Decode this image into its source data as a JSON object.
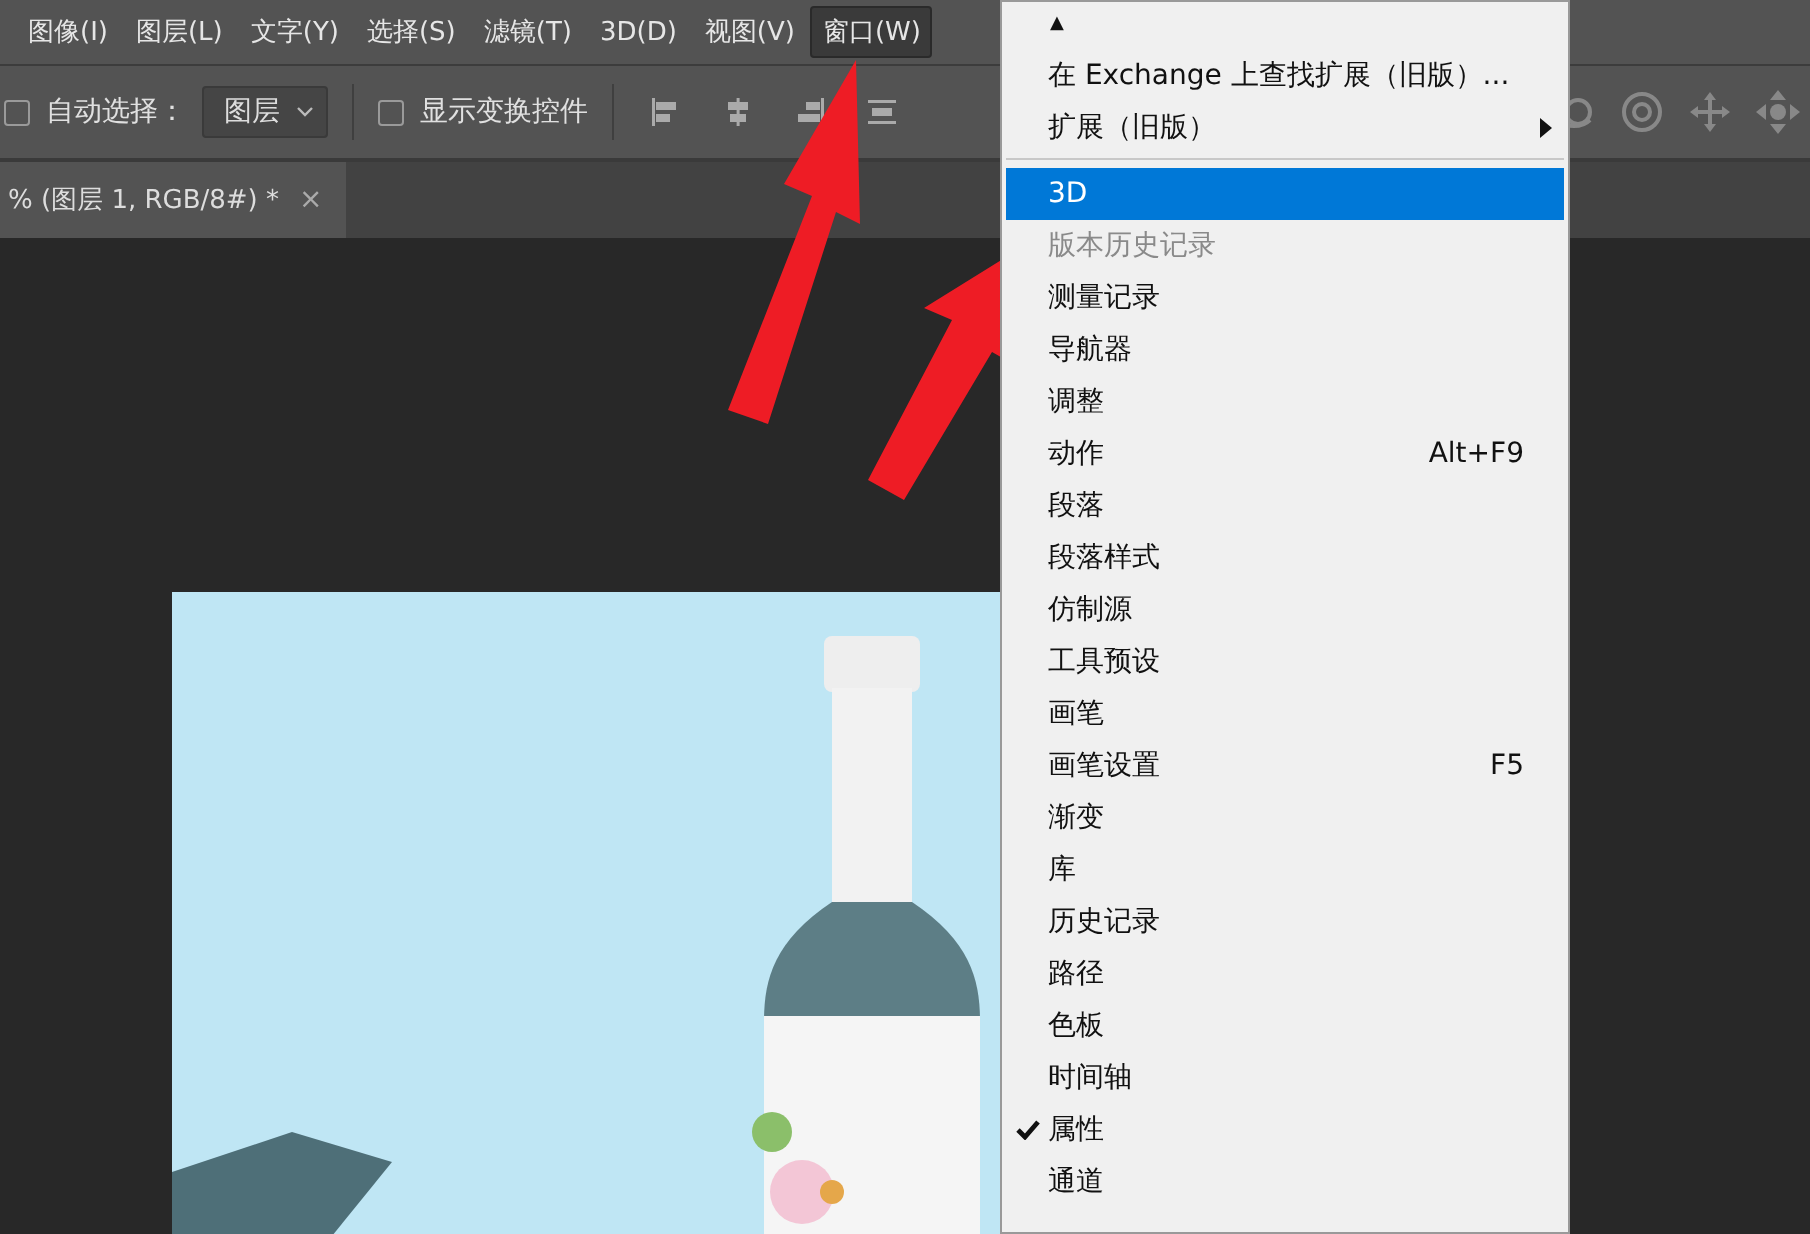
{
  "menu_bar": [
    {
      "label": "图像(I)",
      "selected": false
    },
    {
      "label": "图层(L)",
      "selected": false
    },
    {
      "label": "文字(Y)",
      "selected": false
    },
    {
      "label": "选择(S)",
      "selected": false
    },
    {
      "label": "滤镜(T)",
      "selected": false
    },
    {
      "label": "3D(D)",
      "selected": false
    },
    {
      "label": "视图(V)",
      "selected": false
    },
    {
      "label": "窗口(W)",
      "selected": true
    }
  ],
  "options_bar": {
    "auto_select": {
      "checked": false
    },
    "auto_select_label": "自动选择：",
    "auto_select_target": "图层",
    "transform_controls": {
      "label": "显示变换控件",
      "checked": false
    }
  },
  "document_tab": {
    "title": "% (图层 1, RGB/8#) *",
    "close": "×"
  },
  "window_menu": {
    "scroll_up": "▲",
    "items": [
      {
        "label": "在 Exchange 上查找扩展（旧版）...",
        "kind": "item",
        "selected": false,
        "disabled": false,
        "checked": false
      },
      {
        "label": "扩展（旧版）",
        "kind": "submenu",
        "selected": false,
        "disabled": false,
        "checked": false
      },
      {
        "label": "3D",
        "kind": "separator-before",
        "selected": true,
        "disabled": false,
        "checked": false
      },
      {
        "label": "版本历史记录",
        "kind": "item",
        "selected": false,
        "disabled": true,
        "checked": false
      },
      {
        "label": "测量记录",
        "kind": "item",
        "selected": false,
        "disabled": false,
        "checked": false
      },
      {
        "label": "导航器",
        "kind": "item",
        "selected": false,
        "disabled": false,
        "checked": false
      },
      {
        "label": "调整",
        "kind": "item",
        "selected": false,
        "disabled": false,
        "checked": false
      },
      {
        "label": "动作",
        "shortcut": "Alt+F9",
        "kind": "item",
        "selected": false,
        "disabled": false,
        "checked": false
      },
      {
        "label": "段落",
        "kind": "item",
        "selected": false,
        "disabled": false,
        "checked": false
      },
      {
        "label": "段落样式",
        "kind": "item",
        "selected": false,
        "disabled": false,
        "checked": false
      },
      {
        "label": "仿制源",
        "kind": "item",
        "selected": false,
        "disabled": false,
        "checked": false
      },
      {
        "label": "工具预设",
        "kind": "item",
        "selected": false,
        "disabled": false,
        "checked": false
      },
      {
        "label": "画笔",
        "kind": "item",
        "selected": false,
        "disabled": false,
        "checked": false
      },
      {
        "label": "画笔设置",
        "shortcut": "F5",
        "kind": "item",
        "selected": false,
        "disabled": false,
        "checked": false
      },
      {
        "label": "渐变",
        "kind": "item",
        "selected": false,
        "disabled": false,
        "checked": false
      },
      {
        "label": "库",
        "kind": "item",
        "selected": false,
        "disabled": false,
        "checked": false
      },
      {
        "label": "历史记录",
        "kind": "item",
        "selected": false,
        "disabled": false,
        "checked": false
      },
      {
        "label": "路径",
        "kind": "item",
        "selected": false,
        "disabled": false,
        "checked": false
      },
      {
        "label": "色板",
        "kind": "item",
        "selected": false,
        "disabled": false,
        "checked": false
      },
      {
        "label": "时间轴",
        "kind": "item",
        "selected": false,
        "disabled": false,
        "checked": false
      },
      {
        "label": "属性",
        "kind": "item",
        "selected": false,
        "disabled": false,
        "checked": true
      },
      {
        "label": "通道",
        "kind": "item",
        "selected": false,
        "disabled": false,
        "checked": false
      }
    ]
  }
}
